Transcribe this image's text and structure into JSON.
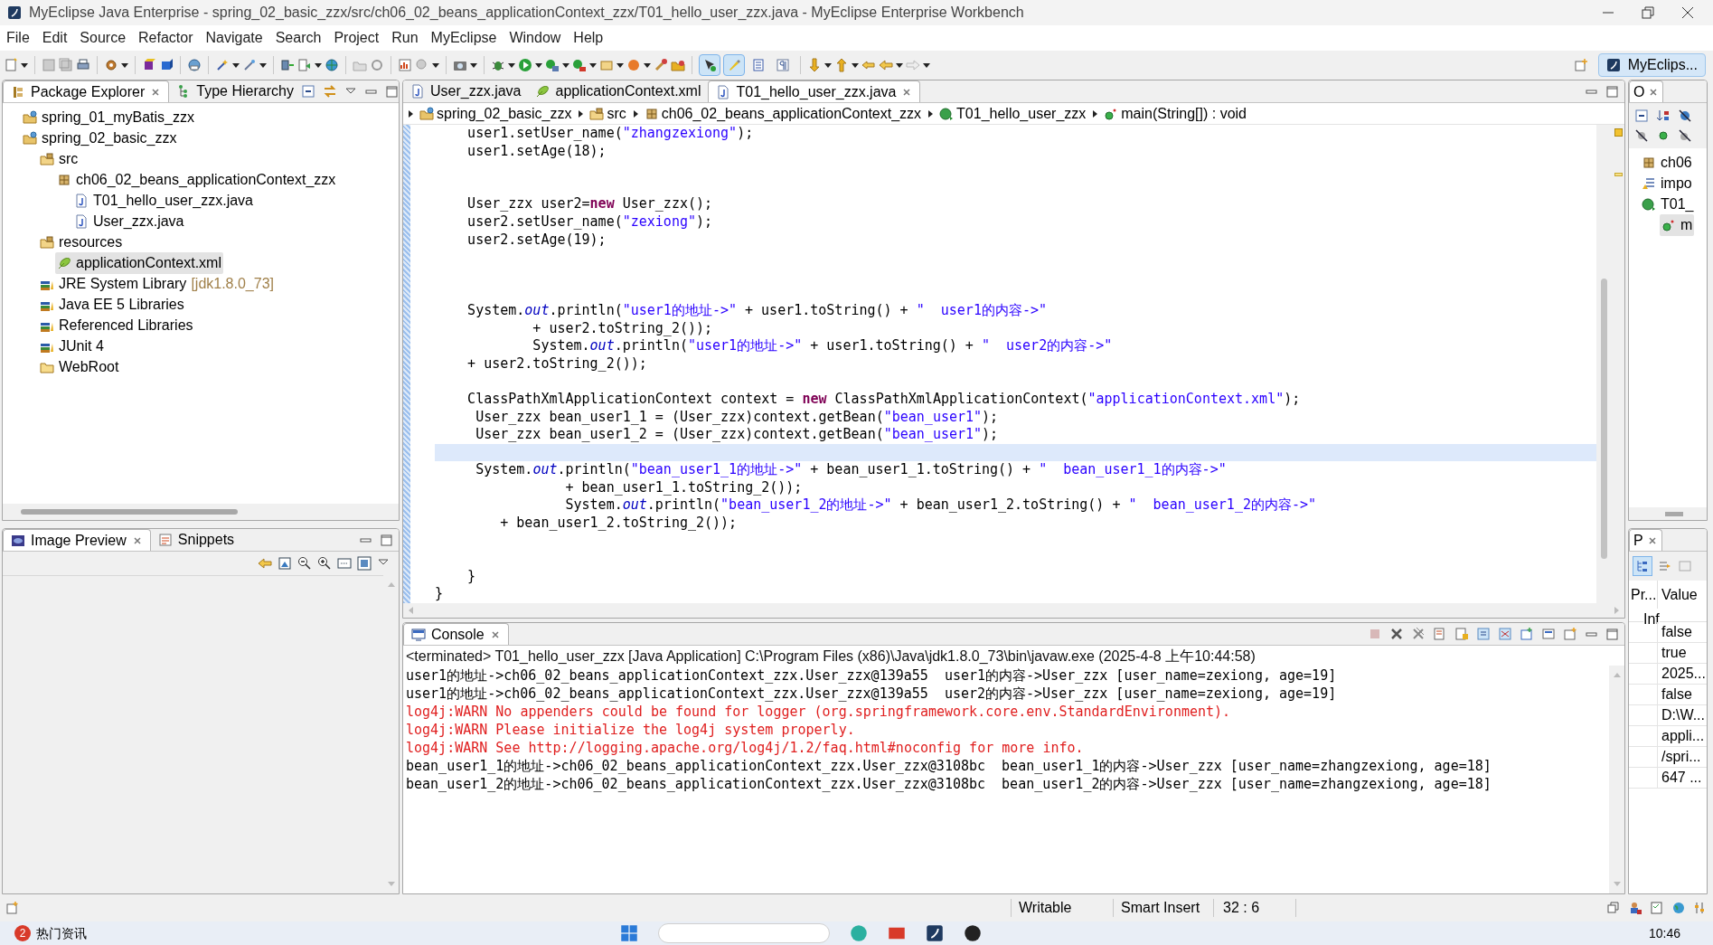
{
  "window": {
    "title": "MyEclipse Java Enterprise - spring_02_basic_zzx/src/ch06_02_beans_applicationContext_zzx/T01_hello_user_zzx.java - MyEclipse Enterprise Workbench"
  },
  "menu": [
    "File",
    "Edit",
    "Source",
    "Refactor",
    "Navigate",
    "Search",
    "Project",
    "Run",
    "MyEclipse",
    "Window",
    "Help"
  ],
  "toolbar": {
    "toggles": [
      {
        "selected": true
      },
      {
        "selected": true
      },
      {
        "selected": false
      },
      {
        "selected": false
      }
    ]
  },
  "perspective": {
    "label": "MyEclips...",
    "selected": true
  },
  "package_explorer": {
    "tabs": [
      {
        "label": "Package Explorer",
        "selected": true
      },
      {
        "label": "Type Hierarchy",
        "selected": false
      }
    ],
    "tree": [
      {
        "label": "spring_01_myBatis_zzx",
        "kind": "project",
        "selected": false
      },
      {
        "label": "spring_02_basic_zzx",
        "kind": "project",
        "selected": false,
        "children": [
          {
            "label": "src",
            "kind": "source-folder",
            "selected": false,
            "children": [
              {
                "label": "ch06_02_beans_applicationContext_zzx",
                "kind": "package",
                "selected": false,
                "children": [
                  {
                    "label": "T01_hello_user_zzx.java",
                    "kind": "java-file",
                    "selected": false
                  },
                  {
                    "label": "User_zzx.java",
                    "kind": "java-file",
                    "selected": false
                  }
                ]
              }
            ]
          },
          {
            "label": "resources",
            "kind": "source-folder",
            "selected": false,
            "children": [
              {
                "label": "applicationContext.xml",
                "kind": "xml-file",
                "selected": true
              }
            ]
          },
          {
            "label": "JRE System Library",
            "decoration": "[jdk1.8.0_73]",
            "kind": "library",
            "selected": false
          },
          {
            "label": "Java EE 5 Libraries",
            "kind": "library",
            "selected": false
          },
          {
            "label": "Referenced Libraries",
            "kind": "library",
            "selected": false
          },
          {
            "label": "JUnit 4",
            "kind": "library",
            "selected": false
          },
          {
            "label": "WebRoot",
            "kind": "folder",
            "selected": false
          }
        ]
      }
    ]
  },
  "image_preview": {
    "tabs": [
      {
        "label": "Image Preview",
        "selected": true
      },
      {
        "label": "Snippets",
        "selected": false
      }
    ]
  },
  "editor": {
    "tabs": [
      {
        "label": "User_zzx.java",
        "kind": "java-file",
        "selected": false
      },
      {
        "label": "applicationContext.xml",
        "kind": "xml-file",
        "selected": false
      },
      {
        "label": "T01_hello_user_zzx.java",
        "kind": "java-file",
        "selected": true
      }
    ],
    "breadcrumb": [
      {
        "label": "spring_02_basic_zzx",
        "kind": "project"
      },
      {
        "label": "src",
        "kind": "source-folder"
      },
      {
        "label": "ch06_02_beans_applicationContext_zzx",
        "kind": "package"
      },
      {
        "label": "T01_hello_user_zzx",
        "kind": "class"
      },
      {
        "label": "main(String[]) : void",
        "kind": "method"
      }
    ],
    "lines": [
      {
        "current": false,
        "tokens": [
          {
            "kind": "plain",
            "text": "    user1.setUser_name("
          },
          {
            "kind": "string",
            "text": "\"zhangzexiong\""
          },
          {
            "kind": "plain",
            "text": ");"
          }
        ]
      },
      {
        "current": false,
        "tokens": [
          {
            "kind": "plain",
            "text": "    user1.setAge(18);"
          }
        ]
      },
      {
        "current": false
      },
      {
        "current": false
      },
      {
        "current": false,
        "tokens": [
          {
            "kind": "plain",
            "text": "    User_zzx user2="
          },
          {
            "kind": "keyword",
            "text": "new"
          },
          {
            "kind": "plain",
            "text": " User_zzx();"
          }
        ]
      },
      {
        "current": false,
        "tokens": [
          {
            "kind": "plain",
            "text": "    user2.setUser_name("
          },
          {
            "kind": "string",
            "text": "\"zexiong\""
          },
          {
            "kind": "plain",
            "text": ");"
          }
        ]
      },
      {
        "current": false,
        "tokens": [
          {
            "kind": "plain",
            "text": "    user2.setAge(19);"
          }
        ]
      },
      {
        "current": false
      },
      {
        "current": false
      },
      {
        "current": false
      },
      {
        "current": false,
        "tokens": [
          {
            "kind": "plain",
            "text": "    System."
          },
          {
            "kind": "field",
            "text": "out"
          },
          {
            "kind": "plain",
            "text": ".println("
          },
          {
            "kind": "string",
            "text": "\"user1的地址->\""
          },
          {
            "kind": "plain",
            "text": " + user1.toString() + "
          },
          {
            "kind": "string",
            "text": "\"  user1的内容->\""
          }
        ]
      },
      {
        "current": false,
        "tokens": [
          {
            "kind": "plain",
            "text": "            + user2.toString_2());"
          }
        ]
      },
      {
        "current": false,
        "tokens": [
          {
            "kind": "plain",
            "text": "            System."
          },
          {
            "kind": "field",
            "text": "out"
          },
          {
            "kind": "plain",
            "text": ".println("
          },
          {
            "kind": "string",
            "text": "\"user1的地址->\""
          },
          {
            "kind": "plain",
            "text": " + user1.toString() + "
          },
          {
            "kind": "string",
            "text": "\"  user2的内容->\""
          }
        ]
      },
      {
        "current": false,
        "tokens": [
          {
            "kind": "plain",
            "text": "    + user2.toString_2());"
          }
        ]
      },
      {
        "current": false
      },
      {
        "current": false,
        "tokens": [
          {
            "kind": "plain",
            "text": "    ClassPathXmlApplicationContext context = "
          },
          {
            "kind": "keyword",
            "text": "new"
          },
          {
            "kind": "plain",
            "text": " ClassPathXmlApplicationContext("
          },
          {
            "kind": "string",
            "text": "\"applicationContext.xml\""
          },
          {
            "kind": "plain",
            "text": ");"
          }
        ]
      },
      {
        "current": false,
        "tokens": [
          {
            "kind": "plain",
            "text": "     User_zzx bean_user1_1 = (User_zzx)context.getBean("
          },
          {
            "kind": "string",
            "text": "\"bean_user1\""
          },
          {
            "kind": "plain",
            "text": ");"
          }
        ]
      },
      {
        "current": false,
        "tokens": [
          {
            "kind": "plain",
            "text": "     User_zzx bean_user1_2 = (User_zzx)context.getBean("
          },
          {
            "kind": "string",
            "text": "\"bean_user1\""
          },
          {
            "kind": "plain",
            "text": ");"
          }
        ]
      },
      {
        "current": true
      },
      {
        "current": false,
        "tokens": [
          {
            "kind": "plain",
            "text": "     System."
          },
          {
            "kind": "field",
            "text": "out"
          },
          {
            "kind": "plain",
            "text": ".println("
          },
          {
            "kind": "string",
            "text": "\"bean_user1_1的地址->\""
          },
          {
            "kind": "plain",
            "text": " + bean_user1_1.toString() + "
          },
          {
            "kind": "string",
            "text": "\"  bean_user1_1的内容->\""
          }
        ]
      },
      {
        "current": false,
        "tokens": [
          {
            "kind": "plain",
            "text": "                + bean_user1_1.toString_2());"
          }
        ]
      },
      {
        "current": false,
        "tokens": [
          {
            "kind": "plain",
            "text": "                System."
          },
          {
            "kind": "field",
            "text": "out"
          },
          {
            "kind": "plain",
            "text": ".println("
          },
          {
            "kind": "string",
            "text": "\"bean_user1_2的地址->\""
          },
          {
            "kind": "plain",
            "text": " + bean_user1_2.toString() + "
          },
          {
            "kind": "string",
            "text": "\"  bean_user1_2的内容->\""
          }
        ]
      },
      {
        "current": false,
        "tokens": [
          {
            "kind": "plain",
            "text": "        + bean_user1_2.toString_2());"
          }
        ]
      },
      {
        "current": false
      },
      {
        "current": false
      },
      {
        "current": false,
        "tokens": [
          {
            "kind": "plain",
            "text": "    }"
          }
        ]
      },
      {
        "current": false,
        "tokens": [
          {
            "kind": "plain",
            "text": "}"
          }
        ]
      }
    ]
  },
  "console": {
    "tab": "Console",
    "header": "<terminated> T01_hello_user_zzx [Java Application] C:\\Program Files (x86)\\Java\\jdk1.8.0_73\\bin\\javaw.exe (2025-4-8 上午10:44:58)",
    "lines": [
      {
        "kind": "stdout",
        "text": "user1的地址->ch06_02_beans_applicationContext_zzx.User_zzx@139a55  user1的内容->User_zzx [user_name=zexiong, age=19]"
      },
      {
        "kind": "stdout",
        "text": "user1的地址->ch06_02_beans_applicationContext_zzx.User_zzx@139a55  user2的内容->User_zzx [user_name=zexiong, age=19]"
      },
      {
        "kind": "stderr",
        "text": "log4j:WARN No appenders could be found for logger (org.springframework.core.env.StandardEnvironment)."
      },
      {
        "kind": "stderr",
        "text": "log4j:WARN Please initialize the log4j system properly."
      },
      {
        "kind": "stderr",
        "text": "log4j:WARN See http://logging.apache.org/log4j/1.2/faq.html#noconfig for more info."
      },
      {
        "kind": "stdout",
        "text": "bean_user1_1的地址->ch06_02_beans_applicationContext_zzx.User_zzx@3108bc  bean_user1_1的内容->User_zzx [user_name=zhangzexiong, age=18]"
      },
      {
        "kind": "stdout",
        "text": "bean_user1_2的地址->ch06_02_beans_applicationContext_zzx.User_zzx@3108bc  bean_user1_2的内容->User_zzx [user_name=zhangzexiong, age=18]"
      }
    ]
  },
  "outline": {
    "tab": "O",
    "items": [
      {
        "label": "ch06",
        "kind": "package",
        "selected": false
      },
      {
        "label": "impo",
        "kind": "imports",
        "selected": false
      },
      {
        "label": "T01_",
        "kind": "class",
        "selected": false,
        "children": [
          {
            "label": "m",
            "kind": "method",
            "selected": true
          }
        ]
      }
    ]
  },
  "properties": {
    "tab": "P",
    "columns": [
      "Pr...",
      "Value"
    ],
    "category": "Inf",
    "values": [
      "false",
      "true",
      "2025...",
      "false",
      "D:\\W...",
      "appli...",
      "/spri...",
      "647 ..."
    ]
  },
  "status_bar": {
    "mode": "Writable",
    "insert": "Smart Insert",
    "position": "32 : 6"
  },
  "taskbar": {
    "news_badge": "2",
    "news": "热门资讯",
    "time": "10:46"
  }
}
